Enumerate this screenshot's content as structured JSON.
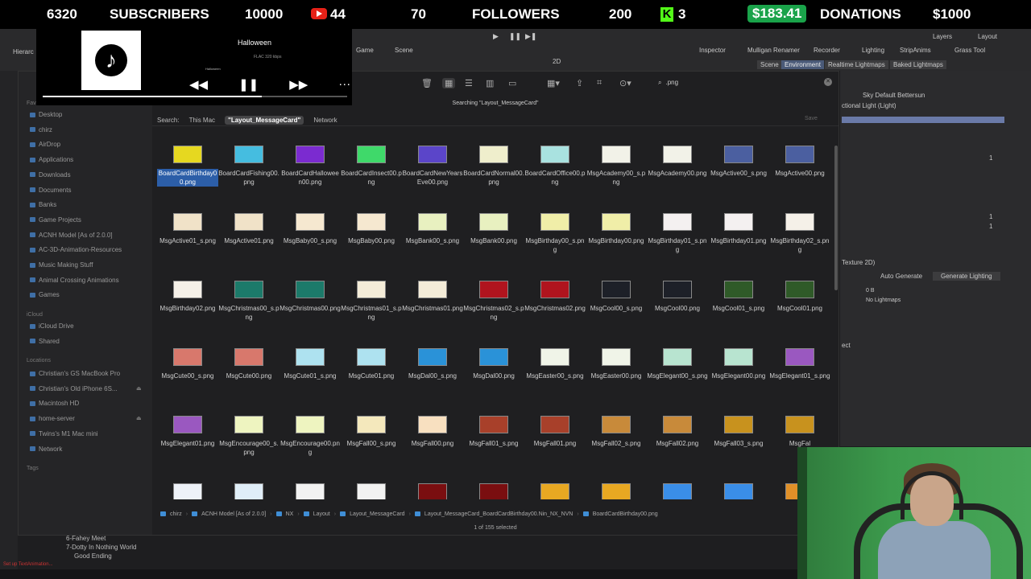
{
  "stream_bar": {
    "subscribers_count": "6320",
    "subscribers_label": "SUBSCRIBERS",
    "subscribers_goal": "10000",
    "youtube_count": "44",
    "followers_count": "70",
    "followers_label": "FOLLOWERS",
    "followers_goal": "200",
    "kick_count": "3",
    "donations_amount": "$183.41",
    "donations_label": "DONATIONS",
    "donations_goal": "$1000",
    "colors": {
      "youtube": "#e62117",
      "kick": "#53fc18",
      "donations": "#1aa34a"
    }
  },
  "music": {
    "title": "Halloween",
    "subtitle": "FLAC 320 kbps",
    "artist": "Halloween",
    "progress_fraction": 0.72,
    "controls": {
      "prev": "◀◀",
      "pause": "❚❚",
      "next": "▶▶",
      "more": "···"
    }
  },
  "unity": {
    "menu_left": "Hierarc",
    "game_tab": "Game",
    "scene_tab": "Scene",
    "tool_2d": "2D",
    "inspector_tab": "Inspector",
    "mulligan_tab": "Mulligan Renamer",
    "recorder_tab": "Recorder",
    "lighting_tab": "Lighting",
    "strip_tab": "StripAnims",
    "grass_tab": "Grass Tool",
    "layers_label": "Layers",
    "layout_label": "Layout",
    "light_scene": "Scene",
    "light_environment": "Environment",
    "light_realtime": "Realtime Lightmaps",
    "light_baked": "Baked Lightmaps",
    "skybox": "Sky Default Bettersun",
    "directional": "ctional Light (Light)",
    "texture": "Texture 2D)",
    "auto_generate": "Auto Generate",
    "generate_lighting": "Generate Lighting",
    "size": "0 B",
    "no_lightmaps": "No Lightmaps",
    "val_1a": "1",
    "val_1b": "1",
    "val_1c": "1",
    "ect": "ect",
    "tree_1": "6-Fahey Meet",
    "tree_2": "7-Dotty In Nothing World",
    "tree_3": "Good Ending",
    "status_text": "Set up TextAnimation..."
  },
  "finder": {
    "sidebar": {
      "favorites_header": "Favorites",
      "favorites": [
        "Desktop",
        "chirz",
        "AirDrop",
        "Applications",
        "Downloads",
        "Documents",
        "Banks",
        "Game Projects",
        "ACNH Model [As of 2.0.0]",
        "AC-3D-Animation-Resources",
        "Music Making Stuff",
        "Animal Crossing Animations",
        "Games"
      ],
      "icloud_header": "iCloud",
      "icloud": [
        "iCloud Drive",
        "Shared"
      ],
      "locations_header": "Locations",
      "locations": [
        "Christian's GS MacBook Pro",
        "Christian's Old iPhone 6S...",
        "Macintosh HD",
        "home-server",
        "Twins's M1 Mac mini",
        "Network"
      ],
      "tags_header": "Tags"
    },
    "toolbar": {
      "search_query": ".png",
      "searching": "Searching \"Layout_MessageCard\""
    },
    "scope": {
      "label": "Search:",
      "this_mac": "This Mac",
      "folder": "\"Layout_MessageCard\"",
      "network": "Network",
      "save": "Save"
    },
    "files": [
      {
        "name": "BoardCardBirthday00.png",
        "color": "#e6d820",
        "selected": true
      },
      {
        "name": "BoardCardFishing00.png",
        "color": "#45bde0"
      },
      {
        "name": "BoardCardHalloween00.png",
        "color": "#7b2bd0"
      },
      {
        "name": "BoardCardInsect00.png",
        "color": "#3fd96a"
      },
      {
        "name": "BoardCardNewYearsEve00.png",
        "color": "#5b45c9"
      },
      {
        "name": "BoardCardNormal00.png",
        "color": "#efeecc"
      },
      {
        "name": "BoardCardOffice00.png",
        "color": "#a9e2e0"
      },
      {
        "name": "MsgAcademy00_s.png",
        "color": "#f2f2e8"
      },
      {
        "name": "MsgAcademy00.png",
        "color": "#f2f2e8"
      },
      {
        "name": "MsgActive00_s.png",
        "color": "#4b5fa0"
      },
      {
        "name": "MsgActive00.png",
        "color": "#4b5fa0"
      },
      {
        "name": "MsgActive01_s.png",
        "color": "#f0e2c8"
      },
      {
        "name": "MsgActive01.png",
        "color": "#f0e2c8"
      },
      {
        "name": "MsgBaby00_s.png",
        "color": "#f6e8d0"
      },
      {
        "name": "MsgBaby00.png",
        "color": "#f6e8d0"
      },
      {
        "name": "MsgBank00_s.png",
        "color": "#e8f0c0"
      },
      {
        "name": "MsgBank00.png",
        "color": "#e8f0c0"
      },
      {
        "name": "MsgBirthday00_s.png",
        "color": "#f0eea8"
      },
      {
        "name": "MsgBirthday00.png",
        "color": "#f0eea8"
      },
      {
        "name": "MsgBirthday01_s.png",
        "color": "#f4f0f0"
      },
      {
        "name": "MsgBirthday01.png",
        "color": "#f4f0f0"
      },
      {
        "name": "MsgBirthday02_s.png",
        "color": "#f5f0e8"
      },
      {
        "name": "MsgBirthday02.png",
        "color": "#f5f0e8"
      },
      {
        "name": "MsgChristmas00_s.png",
        "color": "#1c7a6a"
      },
      {
        "name": "MsgChristmas00.png",
        "color": "#1c7a6a"
      },
      {
        "name": "MsgChristmas01_s.png",
        "color": "#f4ecd8"
      },
      {
        "name": "MsgChristmas01.png",
        "color": "#f4ecd8"
      },
      {
        "name": "MsgChristmas02_s.png",
        "color": "#b0141e"
      },
      {
        "name": "MsgChristmas02.png",
        "color": "#b0141e"
      },
      {
        "name": "MsgCool00_s.png",
        "color": "#1d2028"
      },
      {
        "name": "MsgCool00.png",
        "color": "#1d2028"
      },
      {
        "name": "MsgCool01_s.png",
        "color": "#2f5a28"
      },
      {
        "name": "MsgCool01.png",
        "color": "#2f5a28"
      },
      {
        "name": "MsgCute00_s.png",
        "color": "#d8786c"
      },
      {
        "name": "MsgCute00.png",
        "color": "#d8786c"
      },
      {
        "name": "MsgCute01_s.png",
        "color": "#aee2f0"
      },
      {
        "name": "MsgCute01.png",
        "color": "#aee2f0"
      },
      {
        "name": "MsgDal00_s.png",
        "color": "#2a92d8"
      },
      {
        "name": "MsgDal00.png",
        "color": "#2a92d8"
      },
      {
        "name": "MsgEaster00_s.png",
        "color": "#f0f4e8"
      },
      {
        "name": "MsgEaster00.png",
        "color": "#f0f4e8"
      },
      {
        "name": "MsgElegant00_s.png",
        "color": "#b8e4d0"
      },
      {
        "name": "MsgElegant00.png",
        "color": "#b8e4d0"
      },
      {
        "name": "MsgElegant01_s.png",
        "color": "#9a58c0"
      },
      {
        "name": "MsgElegant01.png",
        "color": "#9a58c0"
      },
      {
        "name": "MsgEncourage00_s.png",
        "color": "#eef4c0"
      },
      {
        "name": "MsgEncourage00.png",
        "color": "#eef4c0"
      },
      {
        "name": "MsgFall00_s.png",
        "color": "#f4e8bc"
      },
      {
        "name": "MsgFall00.png",
        "color": "#f8e0c0"
      },
      {
        "name": "MsgFall01_s.png",
        "color": "#a8402a"
      },
      {
        "name": "MsgFall01.png",
        "color": "#a8402a"
      },
      {
        "name": "MsgFall02_s.png",
        "color": "#c88a3a"
      },
      {
        "name": "MsgFall02.png",
        "color": "#c88a3a"
      },
      {
        "name": "MsgFall03_s.png",
        "color": "#c8921e"
      },
      {
        "name": "MsgFal",
        "color": "#c8921e"
      },
      {
        "name": "",
        "color": "#eef2f8"
      },
      {
        "name": "",
        "color": "#e0eef8"
      },
      {
        "name": "",
        "color": "#f2f2f2"
      },
      {
        "name": "",
        "color": "#f2f2f2"
      },
      {
        "name": "",
        "color": "#7a0e10"
      },
      {
        "name": "",
        "color": "#7a0e10"
      },
      {
        "name": "",
        "color": "#e8a822"
      },
      {
        "name": "",
        "color": "#e8a822"
      },
      {
        "name": "",
        "color": "#3a8ee8"
      },
      {
        "name": "",
        "color": "#3a8ee8"
      },
      {
        "name": "",
        "color": "#e09028"
      }
    ],
    "path": [
      "chirz",
      "ACNH Model [As of 2.0.0]",
      "NX",
      "Layout",
      "Layout_MessageCard",
      "Layout_MessageCard_BoardCardBirthday00.Nin_NX_NVN",
      "BoardCardBirthday00.png"
    ],
    "status": "1 of 155 selected"
  }
}
